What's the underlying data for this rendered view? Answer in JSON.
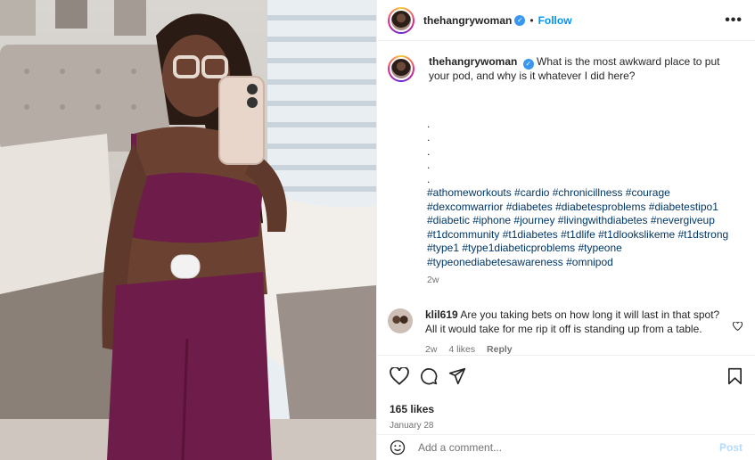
{
  "post": {
    "username": "thehangrywoman",
    "follow_label": "Follow",
    "dot": "•",
    "more_label": "•••",
    "caption_username": "thehangrywoman",
    "caption_text": "What is the most awkward place to put your pod, and why is it whatever I did here?",
    "caption_dots": [
      ".",
      ".",
      ".",
      ".",
      "."
    ],
    "hashtags": "#athomeworkouts #cardio #chronicillness #courage #dexcomwarrior #diabetes #diabetesproblems #diabetestipo1 #diabetic #iphone #journey #livingwithdiabetes #nevergiveup #t1dcommunity #t1diabetes #t1dlife #t1dlookslikeme #t1dstrong #type1 #type1diabeticproblems #typeone #typeonediabetesawareness #omnipod",
    "caption_age": "2w",
    "likes": "165 likes",
    "date": "January 28",
    "verified_mark": "✓"
  },
  "comments": [
    {
      "username": "klil619",
      "text": "Are you taking bets on how long it will last in that spot? All it would take for me rip it off is standing up from a table.",
      "age": "2w",
      "likes": "4 likes",
      "reply_label": "Reply"
    }
  ],
  "add_comment": {
    "placeholder": "Add a comment...",
    "post_label": "Post"
  },
  "icons": {
    "header_more": "more-options-icon",
    "like": "heart-icon",
    "comment": "comment-bubble-icon",
    "share": "paper-plane-icon",
    "save": "bookmark-icon",
    "emoji": "smiley-icon",
    "comment_like": "small-heart-icon"
  },
  "colors": {
    "accent": "#0095f6",
    "hashtag": "#00376b",
    "muted": "#737373",
    "verified": "#3897f0",
    "outfit": "#6e1c4a"
  }
}
